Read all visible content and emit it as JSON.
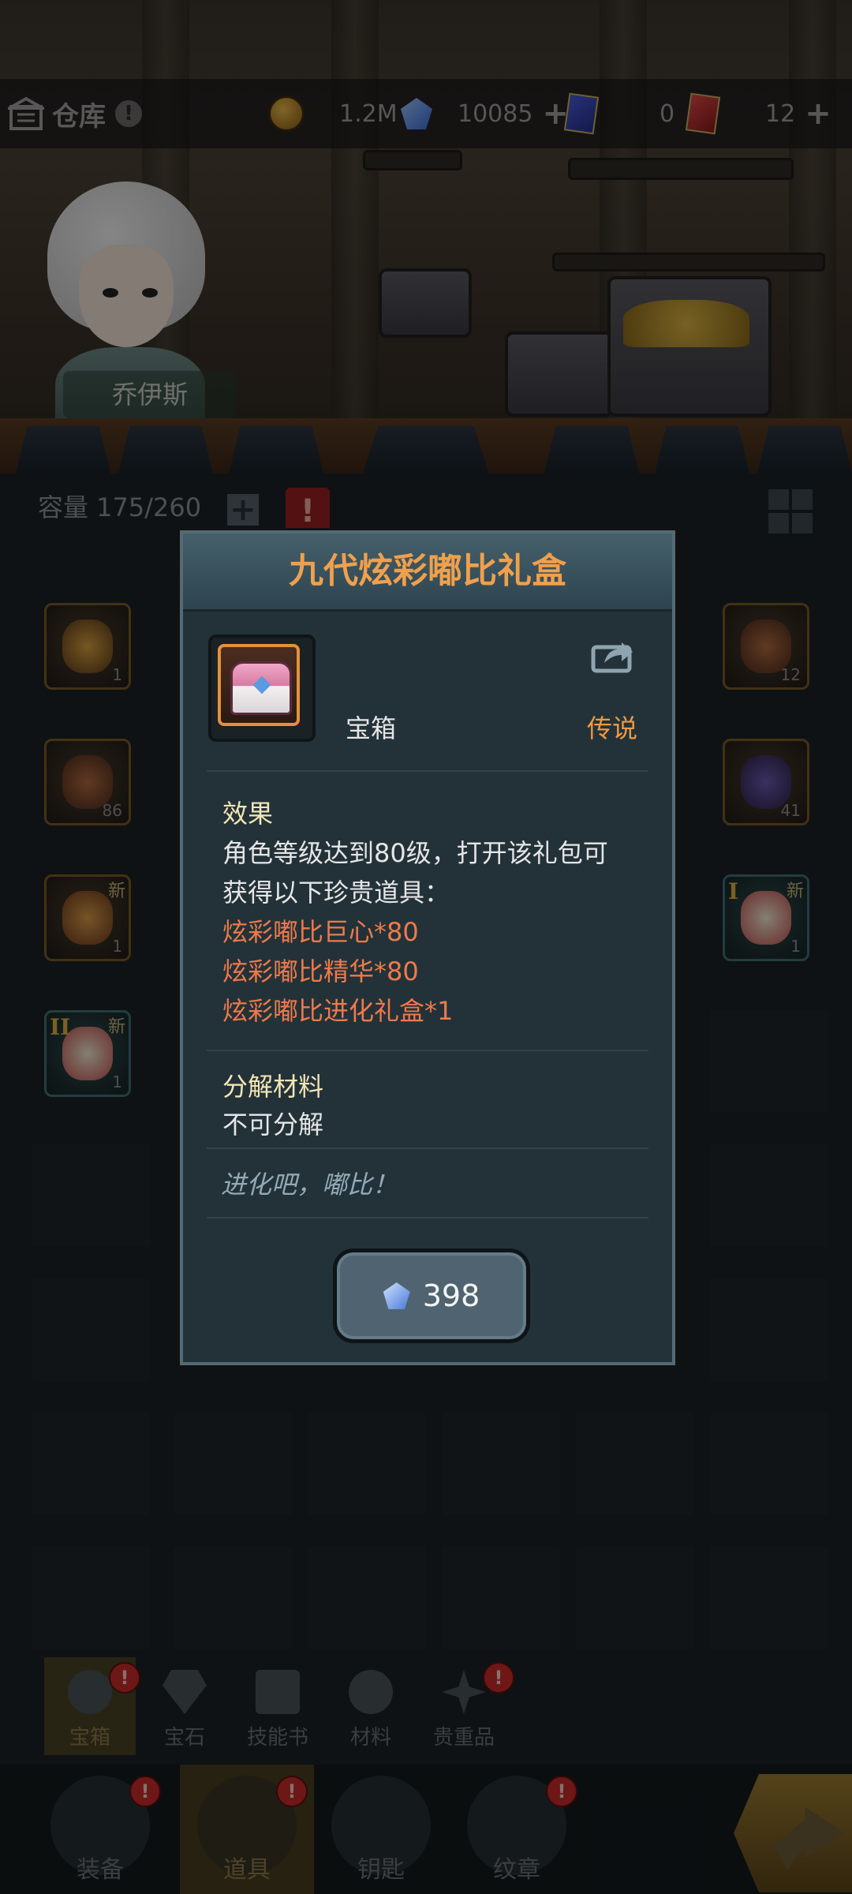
{
  "header": {
    "title": "仓库",
    "warn_label": "!",
    "gold": "1.2M",
    "diamonds": "10085",
    "blue_cards": "0",
    "red_cards": "12",
    "plus": "+",
    "hero_name": "乔伊斯",
    "icons": [
      "warehouse-icon",
      "gold-coin-icon",
      "crystal-icon",
      "blue-card-icon",
      "red-card-icon"
    ]
  },
  "inventory": {
    "capacity_label": "容量 175/260",
    "plus": "+",
    "warn": "!",
    "slots": [
      {
        "count": "1",
        "new": "",
        "rank": ""
      },
      {
        "count": "12",
        "new": "",
        "rank": ""
      },
      {
        "count": "86",
        "new": "",
        "rank": ""
      },
      {
        "count": "41",
        "new": "",
        "rank": ""
      },
      {
        "count": "1",
        "new": "新",
        "rank": ""
      },
      {
        "count": "1",
        "new": "新",
        "rank": "I"
      },
      {
        "count": "1",
        "new": "新",
        "rank": "II"
      }
    ]
  },
  "modal": {
    "title": "九代炫彩嘟比礼盒",
    "type": "宝箱",
    "rarity": "传说",
    "effect_title": "效果",
    "effect_lines": [
      "角色等级达到80级，打开该礼包可",
      "获得以下珍贵道具："
    ],
    "rewards": [
      "炫彩嘟比巨心*80",
      "炫彩嘟比精华*80",
      "炫彩嘟比进化礼盒*1"
    ],
    "decompose_title": "分解材料",
    "decompose_text": "不可分解",
    "flavor": "进化吧，嘟比！",
    "price": "398",
    "colors": {
      "title": "#f0a04c",
      "rarity": "#f09a40",
      "reward": "#ee7a4a"
    }
  },
  "subtabs": [
    {
      "label": "宝箱",
      "badge": "!"
    },
    {
      "label": "宝石",
      "badge": ""
    },
    {
      "label": "技能书",
      "badge": ""
    },
    {
      "label": "材料",
      "badge": ""
    },
    {
      "label": "贵重品",
      "badge": "!"
    }
  ],
  "navtabs": [
    {
      "label": "装备",
      "badge": "!"
    },
    {
      "label": "道具",
      "badge": "!"
    },
    {
      "label": "钥匙",
      "badge": ""
    },
    {
      "label": "纹章",
      "badge": "!"
    }
  ]
}
